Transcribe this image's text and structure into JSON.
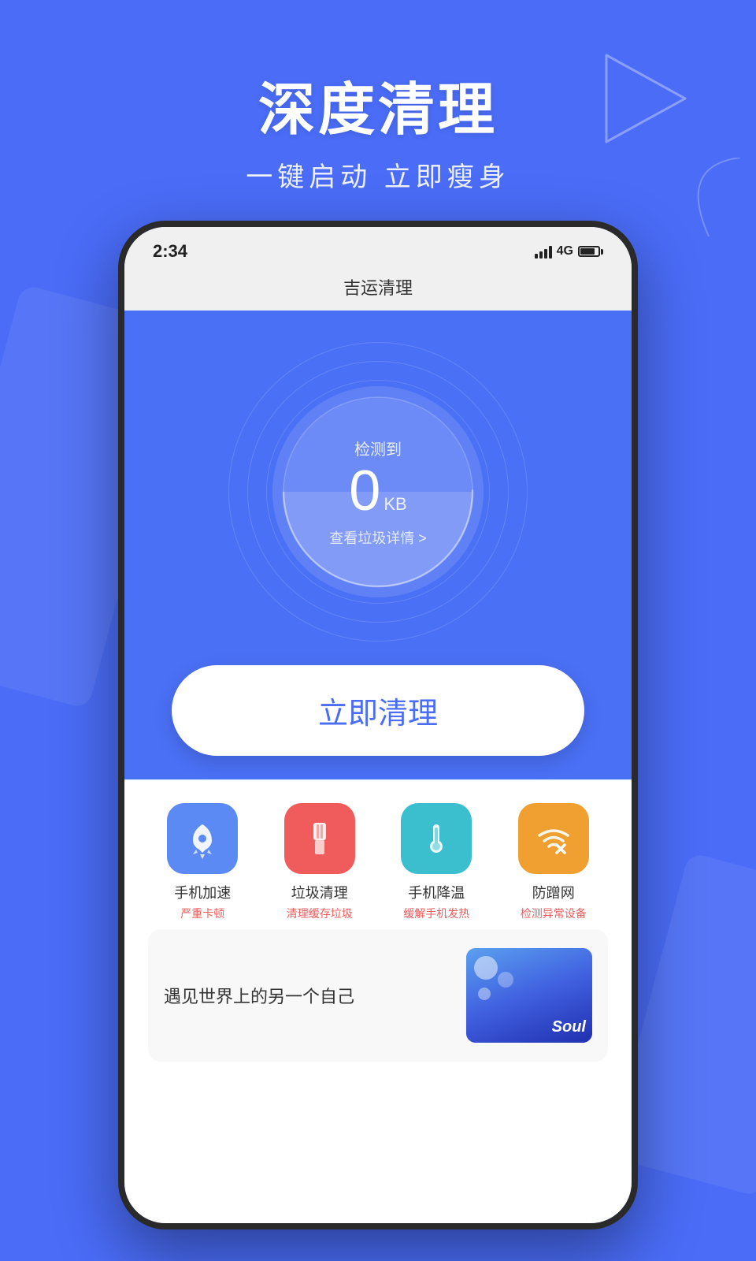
{
  "page": {
    "background_color": "#4a6cf7"
  },
  "header": {
    "main_title": "深度清理",
    "sub_title": "一键启动 立即瘦身"
  },
  "phone": {
    "status_bar": {
      "time": "2:34",
      "signal": "4G",
      "battery_level": 80
    },
    "app_title": "吉运清理",
    "gauge": {
      "label": "检测到",
      "value": "0",
      "unit": "KB",
      "detail": "查看垃圾详情 >"
    },
    "clean_button": "立即清理",
    "features": [
      {
        "name": "手机加速",
        "status": "严重卡顿",
        "icon_color": "blue",
        "icon_type": "rocket"
      },
      {
        "name": "垃圾清理",
        "status": "清理缓存垃圾",
        "icon_color": "red",
        "icon_type": "brush"
      },
      {
        "name": "手机降温",
        "status": "缓解手机发热",
        "icon_color": "cyan",
        "icon_type": "thermometer"
      },
      {
        "name": "防蹭网",
        "status": "检测异常设备",
        "icon_color": "orange",
        "icon_type": "wifi-x"
      }
    ],
    "ad_banner": {
      "text": "遇见世界上的另一个自己",
      "brand": "Soul"
    }
  }
}
